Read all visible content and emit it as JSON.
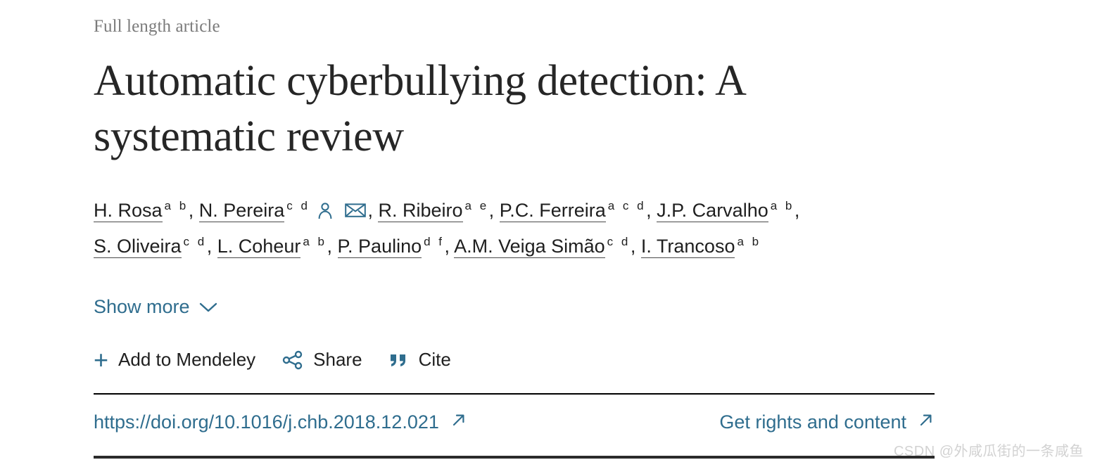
{
  "article": {
    "kicker": "Full length article",
    "title": "Automatic cyberbullying detection: A systematic review"
  },
  "authors": {
    "list": [
      {
        "name": "H. Rosa",
        "affiliations": "a b",
        "trailing": ",",
        "icons": []
      },
      {
        "name": "N. Pereira",
        "affiliations": "c d",
        "trailing": ",",
        "icons": [
          "author-profile-icon",
          "author-email-icon"
        ]
      },
      {
        "name": "R. Ribeiro",
        "affiliations": "a e",
        "trailing": ",",
        "icons": []
      },
      {
        "name": "P.C. Ferreira",
        "affiliations": "a c d",
        "trailing": ",",
        "icons": []
      },
      {
        "name": "J.P. Carvalho",
        "affiliations": "a b",
        "trailing": ",",
        "icons": []
      },
      {
        "name": "S. Oliveira",
        "affiliations": "c d",
        "trailing": ",",
        "icons": []
      },
      {
        "name": "L. Coheur",
        "affiliations": "a b",
        "trailing": ",",
        "icons": []
      },
      {
        "name": "P. Paulino",
        "affiliations": "d f",
        "trailing": ",",
        "icons": []
      },
      {
        "name": "A.M. Veiga Simão",
        "affiliations": "c d",
        "trailing": ",",
        "icons": []
      },
      {
        "name": "I. Trancoso",
        "affiliations": "a b",
        "trailing": "",
        "icons": []
      }
    ],
    "show_more_label": "Show more"
  },
  "actions": {
    "add_to_mendeley_label": "Add to Mendeley",
    "add_to_mendeley_icon": "plus-icon",
    "share_label": "Share",
    "share_icon": "share-nodes-icon",
    "cite_label": "Cite",
    "cite_icon": "quote-icon"
  },
  "links": {
    "doi": "https://doi.org/10.1016/j.chb.2018.12.021",
    "doi_icon": "external-link-icon",
    "rights": "Get rights and content",
    "rights_icon": "external-link-icon"
  },
  "watermark": {
    "text": "CSDN @外咸瓜街的一条咸鱼"
  },
  "colors": {
    "link": "#2f6d8e",
    "title": "#262626",
    "kicker": "#7b7b7b",
    "rule_top": "#000000",
    "rule_bottom": "#2b2b2b"
  }
}
